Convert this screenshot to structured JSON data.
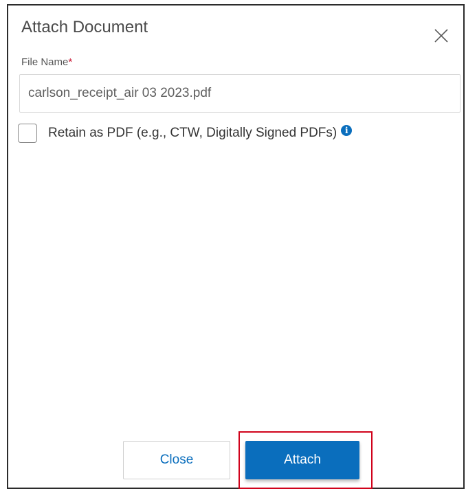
{
  "dialog": {
    "title": "Attach Document",
    "close_icon": "close-x-icon"
  },
  "file_name": {
    "label": "File Name",
    "required_mark": "*",
    "value": "carlson_receipt_air 03 2023.pdf"
  },
  "retain": {
    "label": "Retain as PDF (e.g., CTW, Digitally Signed PDFs)",
    "checked": false,
    "info_icon": "info-icon",
    "info_glyph": "i"
  },
  "buttons": {
    "close_label": "Close",
    "attach_label": "Attach",
    "attach_highlighted": true
  },
  "colors": {
    "accent": "#0a6ebd",
    "required": "#c8102e",
    "highlight": "#d0021b"
  }
}
